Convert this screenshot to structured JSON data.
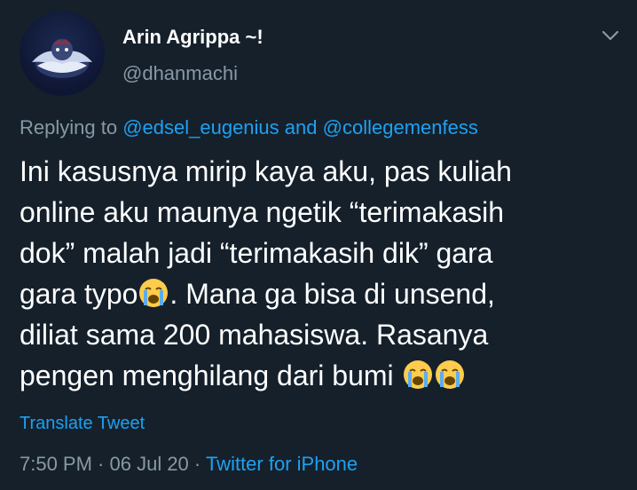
{
  "user": {
    "name": "Arin Agrippa ~!",
    "handle": "@dhanmachi"
  },
  "reply": {
    "prefix": "Replying to",
    "mention1": "@edsel_eugenius",
    "conj": "and",
    "mention2": "@collegemenfess"
  },
  "tweet": {
    "line1": "Ini kasusnya mirip kaya aku, pas kuliah",
    "line2": "online aku maunya ngetik “terimakasih",
    "line3": "dok” malah jadi “terimakasih dik” gara",
    "line4a": "gara typo",
    "line4b": ". Mana ga bisa di unsend,",
    "line5": "diliat sama 200 mahasiswa. Rasanya",
    "line6": "pengen menghilang dari bumi ",
    "emoji": "loudly-crying-face"
  },
  "translate_label": "Translate Tweet",
  "meta": {
    "time": "7:50 PM",
    "sep1": " · ",
    "date": "06 Jul 20",
    "sep2": " · ",
    "source": "Twitter for iPhone"
  },
  "colors": {
    "background": "#15202b",
    "secondary_text": "#8899a6",
    "link": "#1da1f2"
  }
}
